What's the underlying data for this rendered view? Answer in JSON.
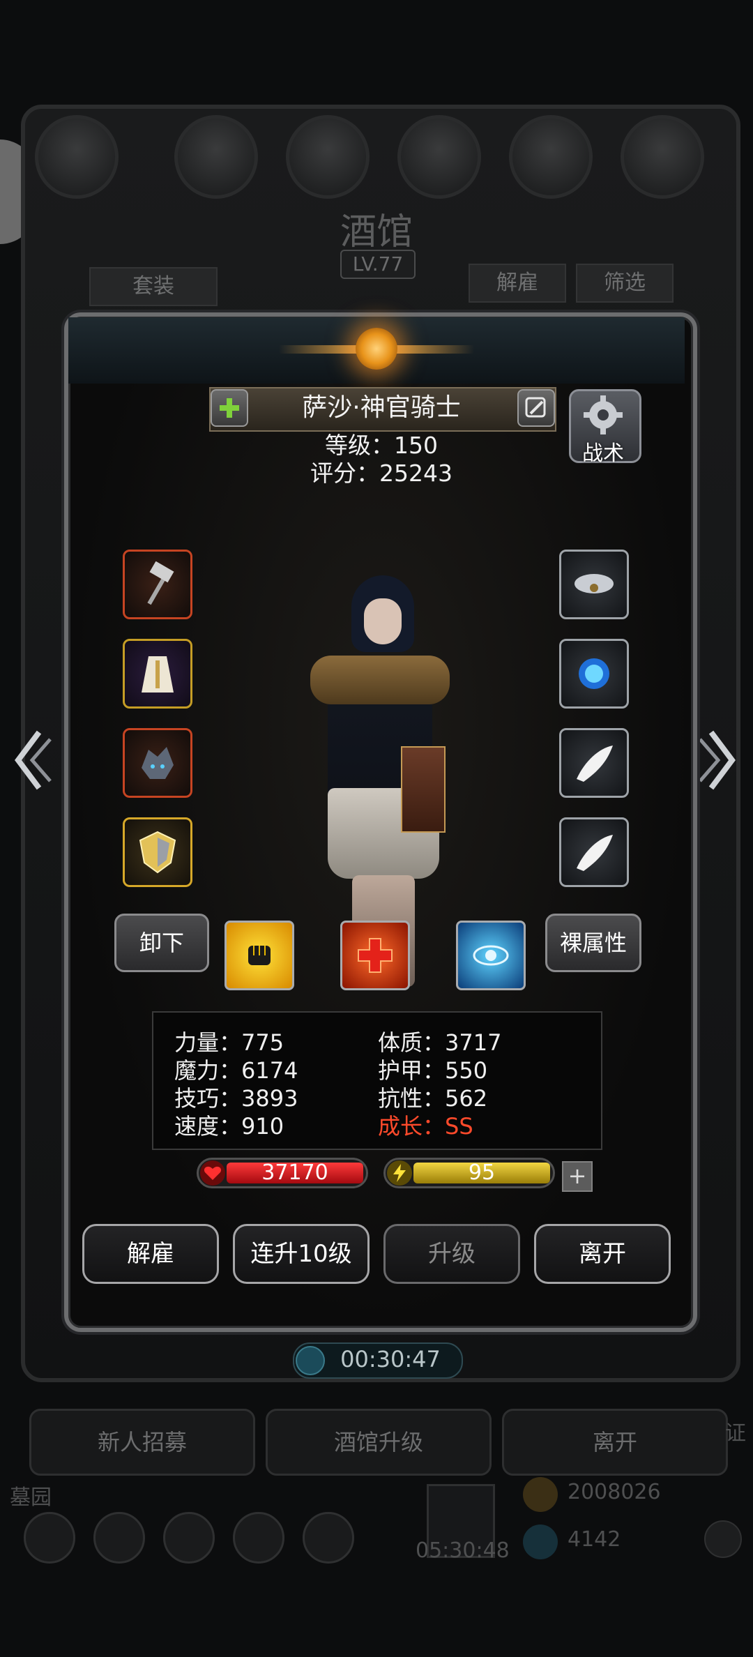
{
  "background": {
    "tavern_title": "酒馆",
    "tavern_level": "LV.77",
    "suit_tab": "套装",
    "dismiss_tab": "解雇",
    "filter_tab": "筛选",
    "recruit_button": "新人招募",
    "upgrade_tavern_button": "酒馆升级",
    "leave_button": "离开",
    "cemetery_label": "墓园",
    "gold_amount": "2008026",
    "gem_amount": "4142",
    "gift_timer": "05:30:48",
    "side_char": "证"
  },
  "hero": {
    "name": "萨沙·神官骑士",
    "level_text": "等级：150",
    "score_text": "评分：25243",
    "tactics_label": "战术"
  },
  "equipment": {
    "left": [
      {
        "icon": "war-hammer-icon",
        "rarity": "red"
      },
      {
        "icon": "priest-robe-icon",
        "rarity": "purple"
      },
      {
        "icon": "dragon-helm-icon",
        "rarity": "red"
      },
      {
        "icon": "golden-shield-icon",
        "rarity": "gold"
      }
    ],
    "right": [
      {
        "icon": "cloud-amulet-icon",
        "rarity": "silver"
      },
      {
        "icon": "blue-orb-icon",
        "rarity": "silver"
      },
      {
        "icon": "white-wing-icon",
        "rarity": "silver"
      },
      {
        "icon": "white-wing-icon",
        "rarity": "silver"
      }
    ]
  },
  "actions": {
    "unequip_label": "卸下",
    "bare_attr_label": "裸属性",
    "skills": [
      "fist-skill-icon",
      "red-cross-skill-icon",
      "eye-skill-icon"
    ]
  },
  "stats": {
    "strength": "力量：775",
    "constitution": "体质：3717",
    "magic": "魔力：6174",
    "armor": "护甲：550",
    "skill": "技巧：3893",
    "resistance": "抗性：562",
    "speed": "速度：910",
    "growth": "成长：SS"
  },
  "bars": {
    "hp": "37170",
    "energy": "95",
    "plus": "+"
  },
  "buttons": {
    "dismiss": "解雇",
    "level_up_10": "连升10级",
    "level_up": "升级",
    "leave": "离开"
  },
  "timer": "00:30:47",
  "colors": {
    "growth": "#ff4a2b",
    "hp_fill": "#d4121a",
    "energy_fill": "#e4c21c"
  }
}
